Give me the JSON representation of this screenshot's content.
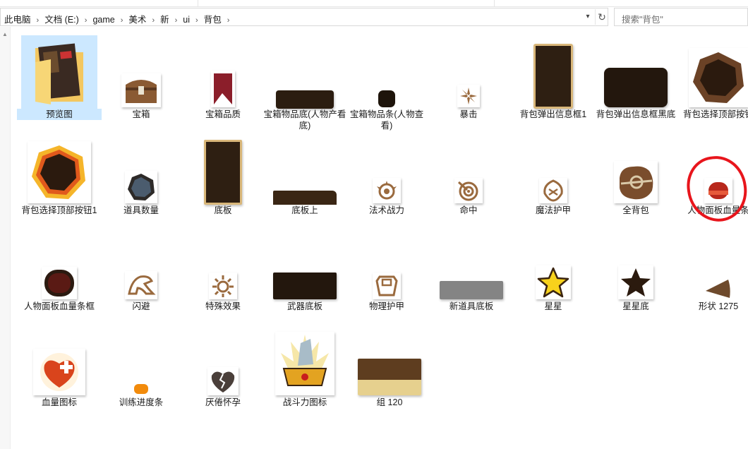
{
  "breadcrumb": [
    "此电脑",
    "文档 (E:)",
    "game",
    "美术",
    "新",
    "ui",
    "背包"
  ],
  "search": {
    "placeholder": "搜索\"背包\""
  },
  "items": [
    {
      "label": "预览图"
    },
    {
      "label": "宝箱"
    },
    {
      "label": "宝箱品质"
    },
    {
      "label": "宝箱物品底(人物产看底)"
    },
    {
      "label": "宝箱物品条(人物查看)"
    },
    {
      "label": "暴击"
    },
    {
      "label": "背包弹出信息框1"
    },
    {
      "label": "背包弹出信息框黑底"
    },
    {
      "label": "背包选择顶部按钮"
    },
    {
      "label": "背包选择顶部按钮1"
    },
    {
      "label": "道具数量"
    },
    {
      "label": "底板"
    },
    {
      "label": "底板上"
    },
    {
      "label": "法术战力"
    },
    {
      "label": "命中"
    },
    {
      "label": "魔法护甲"
    },
    {
      "label": "全背包"
    },
    {
      "label": "人物面板血量条"
    },
    {
      "label": "人物面板血量条框"
    },
    {
      "label": "闪避"
    },
    {
      "label": "特殊效果"
    },
    {
      "label": "武器底板"
    },
    {
      "label": "物理护甲"
    },
    {
      "label": "新道具底板"
    },
    {
      "label": "星星"
    },
    {
      "label": "星星底"
    },
    {
      "label": "形状 1275"
    },
    {
      "label": "血量图标"
    },
    {
      "label": "训练进度条"
    },
    {
      "label": "厌倦怀孕"
    },
    {
      "label": "战斗力图标"
    },
    {
      "label": "组 120"
    }
  ],
  "colors": {
    "selection": "#cce8ff",
    "annotation": "#e8151c",
    "brown_dark": "#2b1d10",
    "brown_icon": "#8a5a33"
  }
}
